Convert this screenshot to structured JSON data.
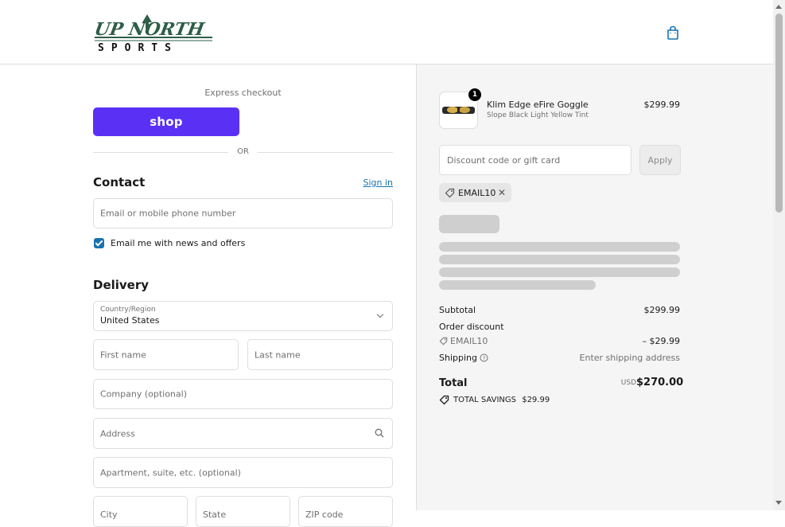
{
  "brand": {
    "logo_line1": "UP NORTH",
    "logo_line2": "SPORTS",
    "logo_color": "#2e5e48"
  },
  "header": {
    "cart_icon": "shopping-bag-icon"
  },
  "express": {
    "label": "Express checkout",
    "shop_button": "shop",
    "shop_color": "#5a31f4",
    "or_divider": "OR"
  },
  "contact": {
    "heading": "Contact",
    "sign_in": "Sign in",
    "email_placeholder": "Email or mobile phone number",
    "newsletter_label": "Email me with news and offers",
    "newsletter_checked": true
  },
  "delivery": {
    "heading": "Delivery",
    "country_label": "Country/Region",
    "country_value": "United States",
    "first_name": "First name",
    "last_name": "Last name",
    "company": "Company (optional)",
    "address": "Address",
    "apartment": "Apartment, suite, etc. (optional)",
    "city": "City",
    "state": "State",
    "zip": "ZIP code"
  },
  "order": {
    "item": {
      "quantity": "1",
      "name": "Klim Edge eFire Goggle",
      "variant": "Slope Black Light Yellow Tint",
      "price": "$299.99"
    },
    "discount_placeholder": "Discount code or gift card",
    "apply_label": "Apply",
    "applied_code": "EMAIL10",
    "remove_icon": "close-icon",
    "subtotal_label": "Subtotal",
    "subtotal_value": "$299.99",
    "order_discount_label": "Order discount",
    "discount_code": "EMAIL10",
    "discount_value": "– $29.99",
    "shipping_label": "Shipping",
    "shipping_value": "Enter shipping address",
    "total_label": "Total",
    "currency": "USD",
    "total_value": "$270.00",
    "savings_label": "TOTAL SAVINGS",
    "savings_value": "$29.99"
  }
}
